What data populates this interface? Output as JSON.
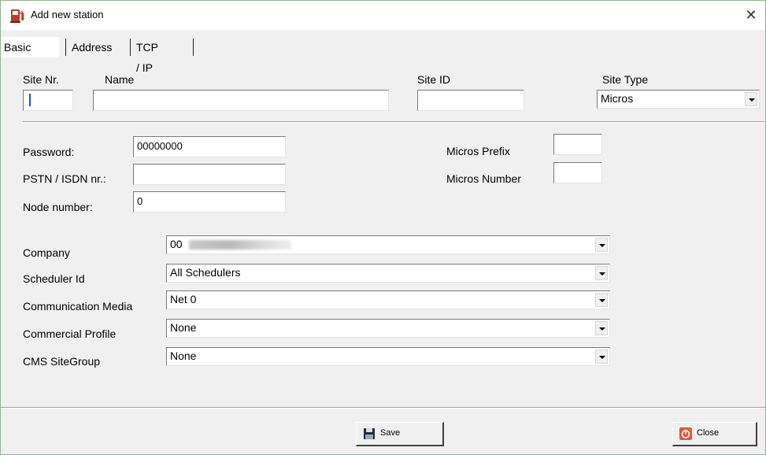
{
  "window": {
    "title": "Add new station",
    "close_glyph": "✕"
  },
  "tabs": [
    {
      "label": "Basic"
    },
    {
      "label": "Address"
    },
    {
      "label": "TCP / IP"
    }
  ],
  "top_fields": {
    "site_nr": {
      "label": "Site Nr.",
      "value": ""
    },
    "name": {
      "label": "Name",
      "value": ""
    },
    "site_id": {
      "label": "Site ID",
      "value": ""
    },
    "site_type": {
      "label": "Site Type",
      "value": "Micros"
    }
  },
  "mid_fields": {
    "password": {
      "label": "Password:",
      "value": "00000000"
    },
    "pstn": {
      "label": "PSTN / ISDN nr.:",
      "value": ""
    },
    "node_number": {
      "label": "Node number:",
      "value": "0"
    },
    "micros_prefix": {
      "label": "Micros Prefix",
      "value": ""
    },
    "micros_number": {
      "label": "Micros Number",
      "value": ""
    }
  },
  "selects": [
    {
      "label": "Company",
      "value": "00"
    },
    {
      "label": "Scheduler Id",
      "value": "All Schedulers"
    },
    {
      "label": "Communication Media",
      "value": "Net 0"
    },
    {
      "label": "Commercial Profile",
      "value": "None"
    },
    {
      "label": "CMS SiteGroup",
      "value": "None"
    }
  ],
  "buttons": {
    "save": "Save",
    "close": "Close"
  },
  "icons": {
    "app": "fuel-pump-icon",
    "save": "floppy-disk-icon",
    "close": "power-icon"
  },
  "colors": {
    "app_icon": "#c0392b",
    "close_icon": "#e2583e",
    "caret": "#1a4fd8"
  }
}
